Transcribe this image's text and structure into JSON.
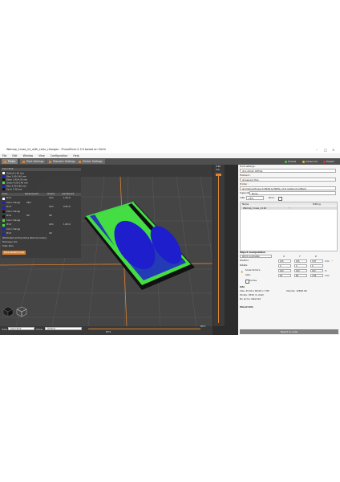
{
  "window": {
    "title": "Wemap_1case_v2_with_color_changes - PrusaSlicer-2.3.0 based on Slic3r"
  },
  "menu": [
    "File",
    "Edit",
    "Window",
    "View",
    "Configuration",
    "Help"
  ],
  "tabs": [
    "Plater",
    "Print Settings",
    "Filament Settings",
    "Printer Settings"
  ],
  "modes": [
    "Simple",
    "Advanced",
    "Expert"
  ],
  "legend": {
    "color_print_header": "Color Print",
    "color_print_items": [
      {
        "label": "Default 1.40 mm",
        "color": "#ffffff"
      },
      {
        "label": "Blue 1.40-3.40 mm",
        "color": "#1e1ecc"
      },
      {
        "label": "Black 3.40-4.20 mm",
        "color": "#111111"
      },
      {
        "label": "Green 4.20-5.40 mm",
        "color": "#44dd44"
      },
      {
        "label": "Blue 5.40-6.80 mm",
        "color": "#1e1ecc"
      },
      {
        "label": "Up to 7.40 mm",
        "color": "#111111"
      }
    ],
    "est_header": [
      "Event",
      "Remaining time",
      "Duration",
      "Used filament"
    ],
    "est_rows": [
      {
        "event": "Print",
        "remaining": "",
        "duration": "14m",
        "filament": "1.09 m",
        "color": "#ffffff"
      },
      {
        "event": "Color change",
        "remaining": "29m",
        "duration": "",
        "filament": "",
        "color": "#1e1ecc"
      },
      {
        "event": "Print",
        "remaining": "",
        "duration": "14m",
        "filament": "0.65 m",
        "color": "#1e1ecc"
      },
      {
        "event": "Color change",
        "remaining": "",
        "duration": "",
        "filament": "",
        "color": "#111111"
      },
      {
        "event": "Print",
        "remaining": "9m",
        "duration": "9m",
        "filament": "",
        "color": "#111111"
      },
      {
        "event": "Color change",
        "remaining": "",
        "duration": "",
        "filament": "",
        "color": "#44dd44"
      },
      {
        "event": "Print",
        "remaining": "",
        "duration": "10m",
        "filament": "1.08 m",
        "color": "#44dd44"
      },
      {
        "event": "Color change",
        "remaining": "",
        "duration": "",
        "filament": "",
        "color": "#1e1ecc"
      },
      {
        "event": "Print",
        "remaining": "",
        "duration": "4m",
        "filament": "",
        "color": "#1e1ecc"
      }
    ],
    "estimated_time_note": "[Estimated printing times (Normal mode)]",
    "first_layer": "First layer:",
    "first_layer_value": "6m",
    "total": "Total:",
    "total_value": "40m",
    "show_stealth_button": "Show stealth mode"
  },
  "bottom": {
    "view_label": "View",
    "view_value": "Color Print",
    "show_label": "Show",
    "show_value": "Options",
    "pos_left": "8072",
    "pos_bottom": "8079"
  },
  "slider": {
    "top_value": "3.40",
    "top_sub": "(38)"
  },
  "right_panel": {
    "print_settings_label": "Print settings :",
    "print_settings_value": "0.20mm DETAIL",
    "filament_label": "Filament :",
    "filament_value": "Generic PLA",
    "printer_label": "Printer :",
    "printer_value": "Original Prusa i3 MK3S & MK3S+ 0.6 nozzle (modified)",
    "supports_label": "Supports:",
    "supports_value": "None",
    "infill_label": "Infill:",
    "infill_value": "15%",
    "brim_label": "Brim:",
    "list_headers": [
      "Name",
      "Editing"
    ],
    "object_name": "Wemap_1case_v2.stl",
    "object_manip_label": "Object manipulation",
    "coords": "World coordinates",
    "axes": [
      "X",
      "Y",
      "Z"
    ],
    "position_label": "Position:",
    "position_values": [
      "125",
      "105",
      "3.87"
    ],
    "position_unit": "mm",
    "rotation_label": "Rotate:",
    "rotation_values": [
      "0",
      "0",
      "0"
    ],
    "scale_label": "Scale factors:",
    "scale_values": [
      "100",
      "100",
      "100"
    ],
    "scale_unit": "%",
    "size_label": "Size:",
    "size_values": [
      "45",
      "80",
      "7.85"
    ],
    "size_unit": "mm",
    "inches_label": "Inches",
    "info_label": "Info",
    "info_size": "45.00 x 80.00 x 7.85",
    "info_volume_label": "Volume:",
    "info_volume": "12892.06",
    "info_facets_label": "Facets:",
    "info_facets": "3636 (1 shell)",
    "info_errors": "No errors detected",
    "sliced_label": "Sliced Info",
    "export_button": "Export G-code"
  },
  "colors": {
    "accent": "#e0832e",
    "blue": "#1e1ecc",
    "green": "#44dd44"
  }
}
